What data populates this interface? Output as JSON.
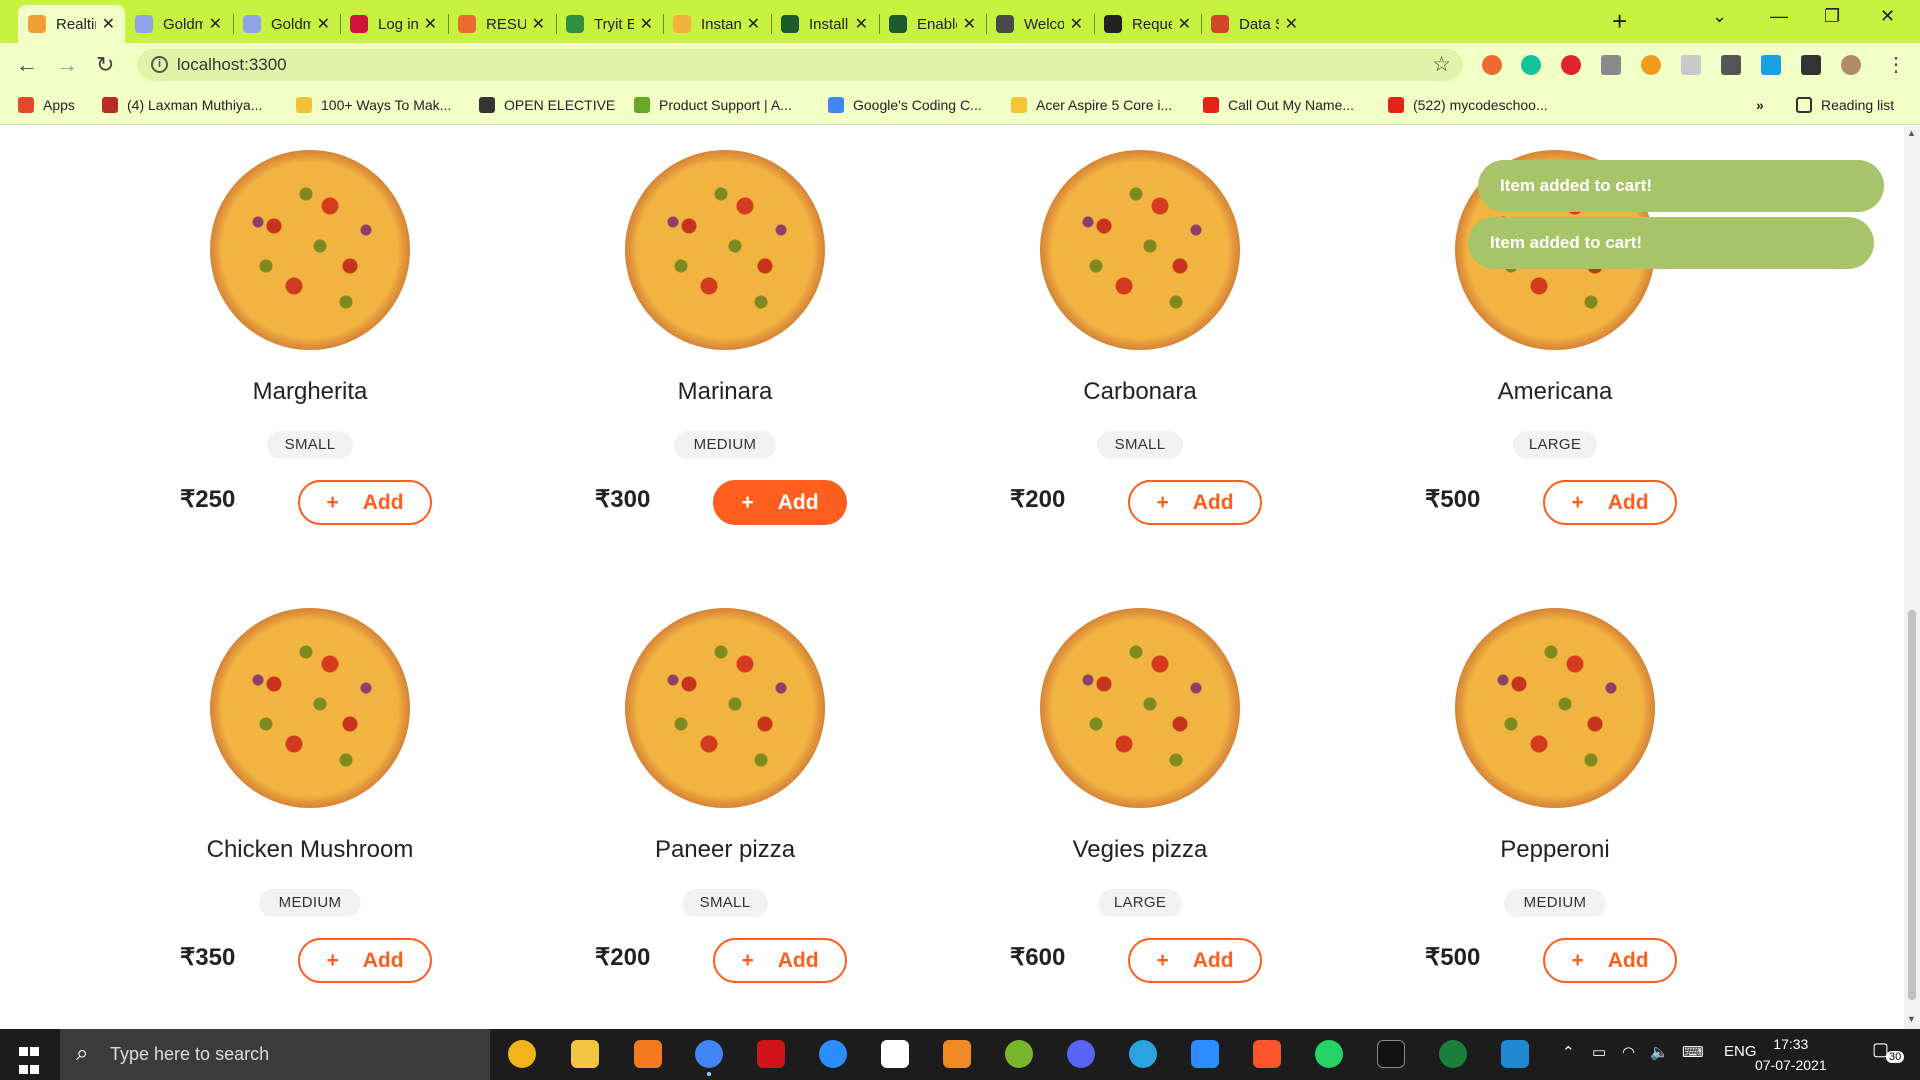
{
  "browser": {
    "tabs": [
      {
        "title": "Realtim",
        "color": "#f0a030",
        "active": true
      },
      {
        "title": "Goldma",
        "color": "#8fa3e8"
      },
      {
        "title": "Goldma",
        "color": "#8fa3e8"
      },
      {
        "title": "Log in -",
        "color": "#d0143a"
      },
      {
        "title": "RESUM",
        "color": "#ef6a2f"
      },
      {
        "title": "Tryit Edi",
        "color": "#2e8f3c"
      },
      {
        "title": "Instance",
        "color": "#f2b33d"
      },
      {
        "title": "Install M",
        "color": "#1d5a2e"
      },
      {
        "title": "Enable",
        "color": "#1d5a2e"
      },
      {
        "title": "Welcom",
        "color": "#4a4a4a"
      },
      {
        "title": "Request",
        "color": "#222222"
      },
      {
        "title": "Data Str",
        "color": "#d0442a"
      }
    ],
    "url": "localhost:3300",
    "bookmarks": [
      {
        "label": "Apps",
        "color": "#e04a2a"
      },
      {
        "label": "(4) Laxman Muthiya...",
        "color": "#b92b27"
      },
      {
        "label": "100+ Ways To Mak...",
        "color": "#f2c230"
      },
      {
        "label": "OPEN ELECTIVE",
        "color": "#333333"
      },
      {
        "label": "Product Support | A...",
        "color": "#6aa628"
      },
      {
        "label": "Google's Coding C...",
        "color": "#4285f4"
      },
      {
        "label": "Acer Aspire 5 Core i...",
        "color": "#f7c531"
      },
      {
        "label": "Call Out My Name...",
        "color": "#e62117"
      },
      {
        "label": "(522) mycodeschoo...",
        "color": "#e62117"
      }
    ],
    "more_bookmarks": "»",
    "reading_list": "Reading list"
  },
  "menu": {
    "items": [
      {
        "name": "Margherita",
        "size": "SMALL",
        "price": "₹250"
      },
      {
        "name": "Marinara",
        "size": "MEDIUM",
        "price": "₹300"
      },
      {
        "name": "Carbonara",
        "size": "SMALL",
        "price": "₹200"
      },
      {
        "name": "Americana",
        "size": "LARGE",
        "price": "₹500"
      },
      {
        "name": "Chicken Mushroom",
        "size": "MEDIUM",
        "price": "₹350"
      },
      {
        "name": "Paneer pizza",
        "size": "SMALL",
        "price": "₹200"
      },
      {
        "name": "Vegies pizza",
        "size": "LARGE",
        "price": "₹600"
      },
      {
        "name": "Pepperoni",
        "size": "MEDIUM",
        "price": "₹500"
      }
    ],
    "add_label": "Add",
    "add_symbol": "+",
    "accent_color": "#fe5f1e"
  },
  "toasts": [
    "Item added to cart!",
    "Item added to cart!"
  ],
  "taskbar": {
    "search_placeholder": "Type here to search",
    "language": "ENG",
    "time": "17:33",
    "date": "07-07-2021",
    "notification_count": "30"
  }
}
